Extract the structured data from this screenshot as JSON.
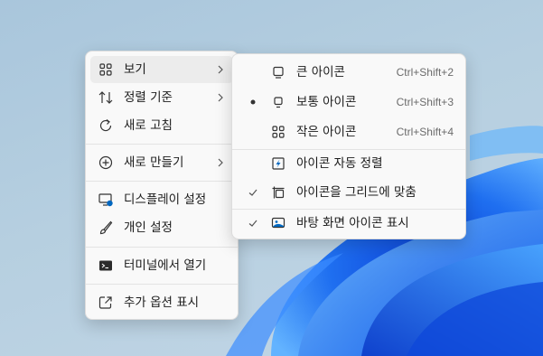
{
  "main_menu": {
    "items": [
      {
        "label": "보기",
        "icon": "grid-icon"
      },
      {
        "label": "정렬 기준",
        "icon": "sort-icon"
      },
      {
        "label": "새로 고침",
        "icon": "refresh-icon"
      },
      {
        "label": "새로 만들기",
        "icon": "add-icon"
      },
      {
        "label": "디스플레이 설정",
        "icon": "display-icon"
      },
      {
        "label": "개인 설정",
        "icon": "brush-icon"
      },
      {
        "label": "터미널에서 열기",
        "icon": "terminal-icon"
      },
      {
        "label": "추가 옵션 표시",
        "icon": "open-external-icon"
      }
    ]
  },
  "view_submenu": {
    "items": [
      {
        "label": "큰 아이콘",
        "shortcut": "Ctrl+Shift+2",
        "icon": "monitor-large-icon"
      },
      {
        "label": "보통 아이콘",
        "shortcut": "Ctrl+Shift+3",
        "icon": "monitor-medium-icon",
        "selected": true
      },
      {
        "label": "작은 아이콘",
        "shortcut": "Ctrl+Shift+4",
        "icon": "grid-small-icon"
      },
      {
        "label": "아이콘 자동 정렬",
        "icon": "auto-arrange-icon"
      },
      {
        "label": "아이콘을 그리드에 맞춤",
        "icon": "align-grid-icon",
        "checked": true
      },
      {
        "label": "바탕 화면 아이콘 표시",
        "icon": "desktop-icon",
        "checked": true
      }
    ]
  },
  "colors": {
    "accent": "#0067c0",
    "menu_bg": "#f9f9f9",
    "hover": "#ececec"
  }
}
